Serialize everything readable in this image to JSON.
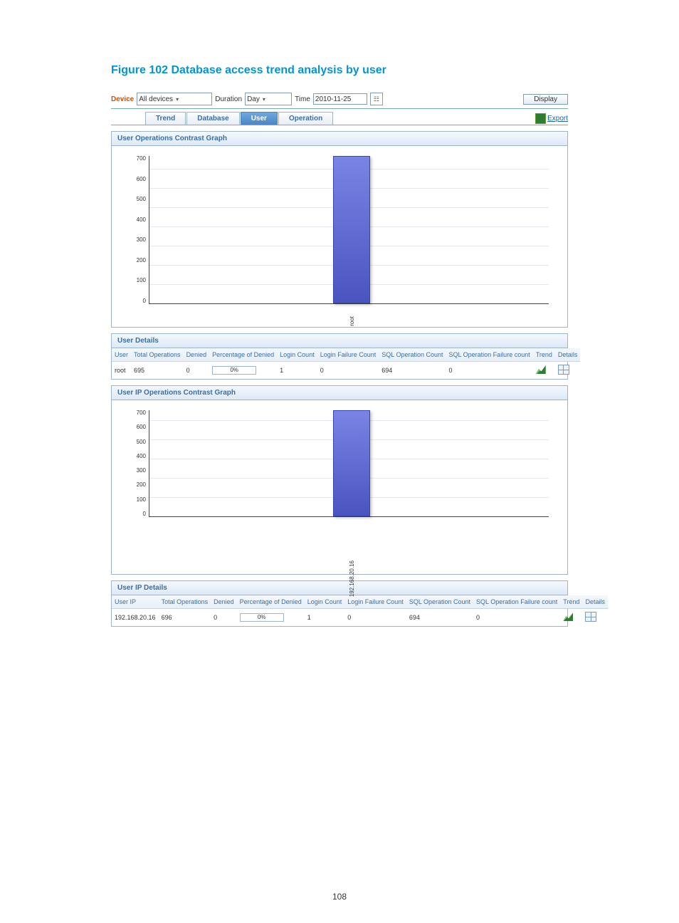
{
  "figure": {
    "title": "Figure 102 Database access trend analysis by user"
  },
  "filters": {
    "device_label": "Device",
    "device_value": "All devices",
    "duration_label": "Duration",
    "duration_value": "Day",
    "time_label": "Time",
    "time_value": "2010-11-25",
    "display_btn": "Display"
  },
  "tabs": {
    "trend": "Trend",
    "database": "Database",
    "user": "User",
    "operation": "Operation"
  },
  "export_label": "Export",
  "panel1": {
    "title": "User Operations Contrast Graph"
  },
  "panel2": {
    "title": "User Details"
  },
  "panel3": {
    "title": "User IP Operations Contrast Graph"
  },
  "panel4": {
    "title": "User IP Details"
  },
  "user_details": {
    "headers": {
      "user": "User",
      "total": "Total Operations",
      "denied": "Denied",
      "pct_denied": "Percentage of Denied",
      "login": "Login Count",
      "login_fail": "Login Failure Count",
      "sql": "SQL Operation Count",
      "sql_fail": "SQL Operation Failure count",
      "trend": "Trend",
      "details": "Details"
    },
    "row": {
      "user": "root",
      "total": "695",
      "denied": "0",
      "pct_denied": "0%",
      "login": "1",
      "login_fail": "0",
      "sql": "694",
      "sql_fail": "0"
    }
  },
  "userip_details": {
    "headers": {
      "userip": "User IP",
      "total": "Total Operations",
      "denied": "Denied",
      "pct_denied": "Percentage of Denied",
      "login": "Login Count",
      "login_fail": "Login Failure Count",
      "sql": "SQL Operation Count",
      "sql_fail": "SQL Operation Failure count",
      "trend": "Trend",
      "details": "Details"
    },
    "row": {
      "userip": "192.168.20.16",
      "total": "696",
      "denied": "0",
      "pct_denied": "0%",
      "login": "1",
      "login_fail": "0",
      "sql": "694",
      "sql_fail": "0"
    }
  },
  "chart_data": [
    {
      "type": "bar",
      "title": "User Operations Contrast Graph",
      "categories": [
        "root"
      ],
      "values": [
        695
      ],
      "xlabel": "",
      "ylabel": "",
      "ylim": [
        0,
        700
      ],
      "yticks": [
        700,
        600,
        500,
        400,
        300,
        200,
        100,
        0
      ]
    },
    {
      "type": "bar",
      "title": "User IP Operations Contrast Graph",
      "categories": [
        "192.168.20.16"
      ],
      "values": [
        696
      ],
      "xlabel": "",
      "ylabel": "",
      "ylim": [
        0,
        700
      ],
      "yticks": [
        700,
        600,
        500,
        400,
        300,
        200,
        100,
        0
      ]
    }
  ],
  "page_number": "108"
}
